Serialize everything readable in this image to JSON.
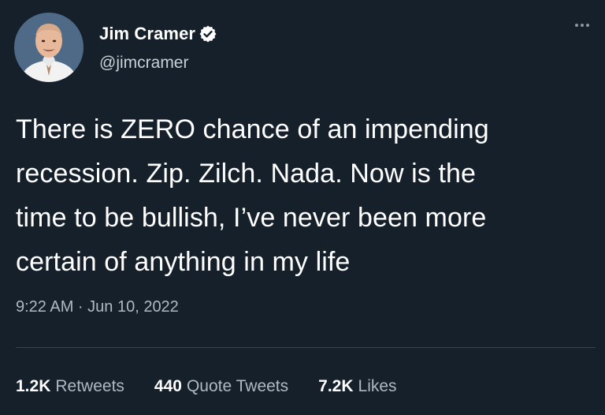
{
  "tweet": {
    "display_name": "Jim Cramer",
    "handle": "@jimcramer",
    "verified": true,
    "text": "There is ZERO chance of an impending\nrecession. Zip. Zilch. Nada. Now is the\ntime to be bullish, I’ve never been more\ncertain of anything in my life",
    "timestamp": "9:22 AM · Jun 10, 2022"
  },
  "stats": {
    "retweets_count": "1.2K",
    "retweets_label": "Retweets",
    "quotes_count": "440",
    "quotes_label": "Quote Tweets",
    "likes_count": "7.2K",
    "likes_label": "Likes"
  },
  "icons": {
    "verified": "verified-badge-icon",
    "more": "more-options-icon"
  },
  "colors": {
    "background": "#15202b",
    "verified_blue": "#1d9bf0",
    "secondary_text": "#aeb9c4"
  }
}
